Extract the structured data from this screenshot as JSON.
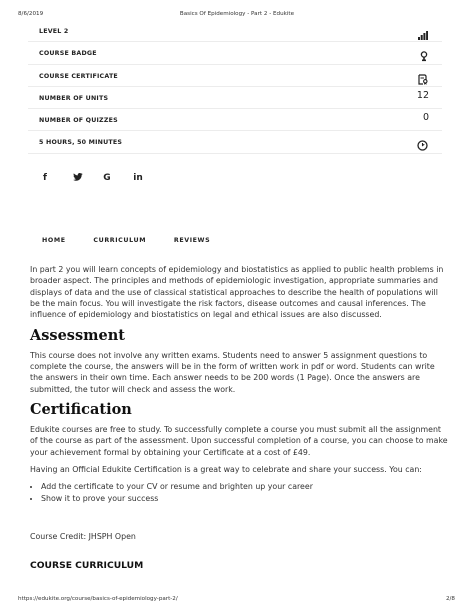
{
  "print_header": {
    "date": "8/6/2019",
    "title": "Basics Of Epidemiology - Part 2 - Edukite"
  },
  "info_rows": [
    {
      "label": "LEVEL 2",
      "icon": "bar-chart-icon"
    },
    {
      "label": "COURSE BADGE",
      "icon": "badge-icon"
    },
    {
      "label": "COURSE CERTIFICATE",
      "icon": "certificate-icon"
    },
    {
      "label": "NUMBER OF UNITS",
      "value": "12"
    },
    {
      "label": "NUMBER OF QUIZZES",
      "value": "0"
    },
    {
      "label": "5 HOURS, 50 MINUTES",
      "icon": "clock-icon"
    }
  ],
  "social": [
    "f",
    "twitter-icon",
    "G",
    "in"
  ],
  "tabs": [
    "HOME",
    "CURRICULUM",
    "REVIEWS"
  ],
  "intro": "In part 2 you will learn concepts of epidemiology and biostatistics as applied to public health problems in broader aspect. The principles and methods of epidemiologic investigation, appropriate summaries and displays of data and the use of classical statistical approaches to describe the health of populations will be the main focus.  You will investigate the risk factors, disease outcomes and causal inferences. The influence of epidemiology and biostatistics on legal and ethical issues are also discussed.",
  "assessment": {
    "heading": "Assessment",
    "text": "This course does not involve any written exams. Students need to answer 5 assignment questions to complete the course, the answers will be in the form of written work in pdf or word. Students can write the answers in their own time. Each answer needs to be 200 words (1 Page). Once the answers are submitted, the tutor will check and assess the work."
  },
  "certification": {
    "heading": "Certification",
    "text1": "Edukite courses are free to study. To successfully complete a course you must submit all the assignment of the course as part of the assessment. Upon successful completion of a course, you can choose to make your achievement formal by obtaining your Certificate at a cost of £49.",
    "text2": "Having an Official Edukite Certification is a great way to celebrate and share your success. You can:",
    "bullets": [
      "Add the certificate to your CV or resume and brighten up your career",
      "Show it to prove your success"
    ]
  },
  "course_credit": "Course Credit: JHSPH Open",
  "curriculum_heading": "COURSE CURRICULUM",
  "print_footer": {
    "url": "https://edukite.org/course/basics-of-epidemiology-part-2/",
    "page": "2/8"
  },
  "colors": {
    "text": "#222222",
    "divider": "#ececec"
  }
}
